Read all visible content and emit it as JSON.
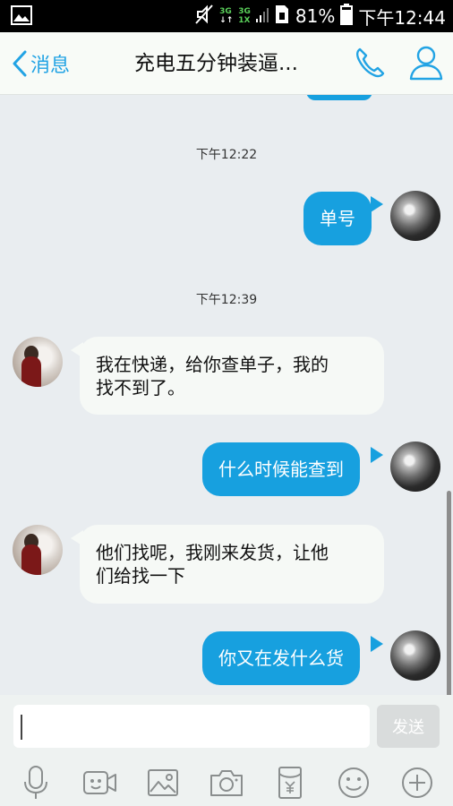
{
  "status_bar": {
    "network_top": "3G",
    "network_bottom": "1X",
    "battery_percent": "81%",
    "time": "下午12:44"
  },
  "header": {
    "back_label": "消息",
    "title": "充电五分钟装逼..."
  },
  "chat": {
    "messages": [
      {
        "type": "timestamp",
        "text": "下午12:22"
      },
      {
        "type": "outgoing",
        "text": "单号"
      },
      {
        "type": "timestamp",
        "text": "下午12:39"
      },
      {
        "type": "incoming",
        "line1": "我在快递，给你查单子，我的",
        "line2": "找不到了。"
      },
      {
        "type": "outgoing",
        "text": "什么时候能查到"
      },
      {
        "type": "incoming",
        "line1": "他们找呢，我刚来发货，让他",
        "line2": "们给找一下"
      },
      {
        "type": "outgoing",
        "text": "你又在发什么货"
      }
    ]
  },
  "input_bar": {
    "input_value": "",
    "send_label": "发送",
    "tools": [
      "voice-icon",
      "video-call-icon",
      "image-icon",
      "camera-icon",
      "red-packet-icon",
      "emoji-icon",
      "more-plus-icon"
    ]
  },
  "colors": {
    "accent": "#22a3e4",
    "outgoing_bubble": "#17a0df",
    "incoming_bubble": "#f6f9f6",
    "chat_background": "#e9edf0"
  }
}
